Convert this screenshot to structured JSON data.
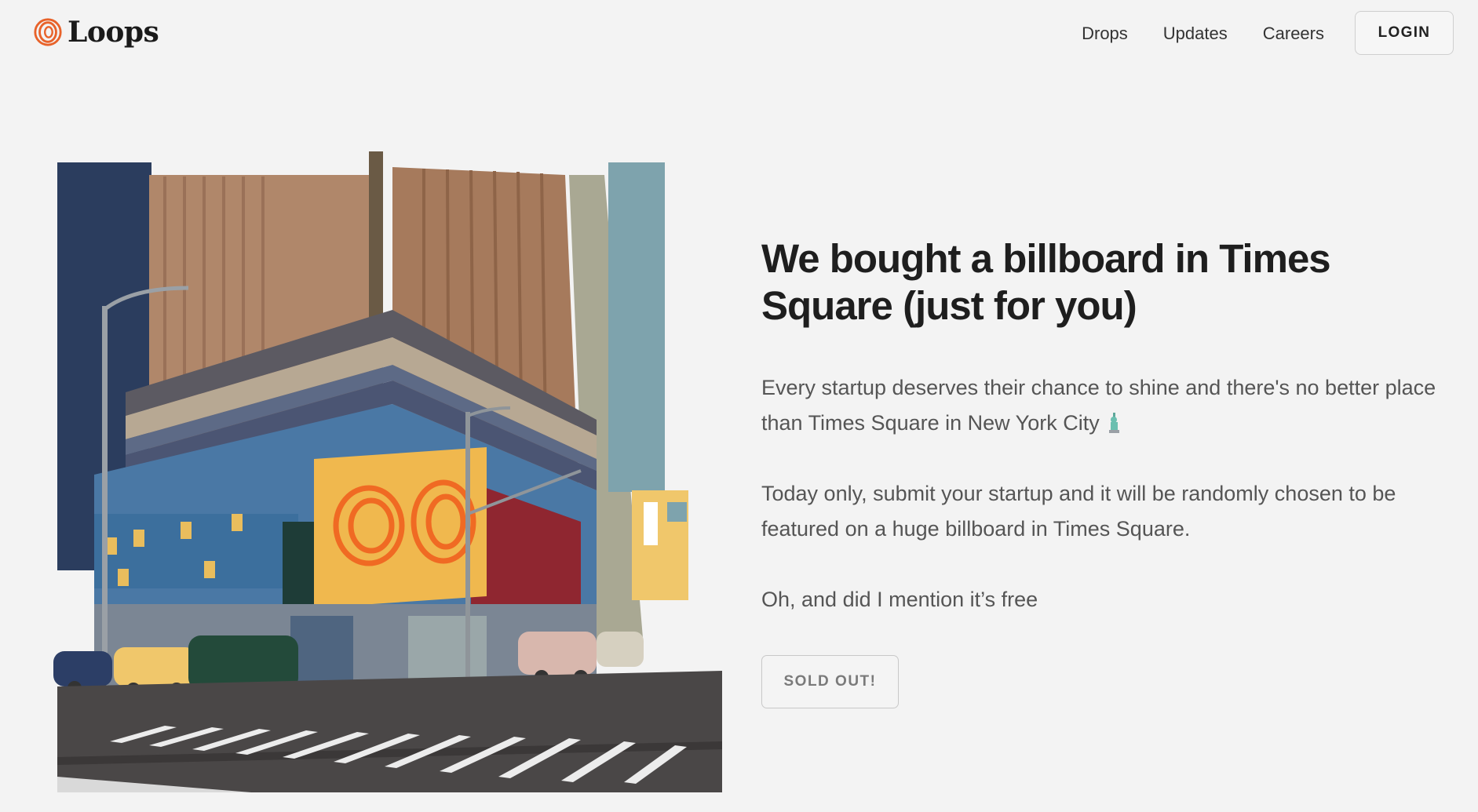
{
  "brand": {
    "name": "Loops",
    "accent": "#e8622a"
  },
  "nav": {
    "items": [
      {
        "label": "Drops"
      },
      {
        "label": "Updates"
      },
      {
        "label": "Careers"
      }
    ],
    "login_label": "LOGIN"
  },
  "hero": {
    "illustration_icon": "times-square-billboard-illustration",
    "headline": "We bought a billboard in Times Square (just for you)",
    "paragraph1": "Every startup deserves their chance to shine and there's no better place than Times Square in New York City",
    "paragraph1_emoji": "statue-of-liberty-icon",
    "paragraph2": "Today only, submit your startup and it will be randomly chosen to be featured on a huge billboard in Times Square.",
    "paragraph3": "Oh, and did I mention it’s free",
    "cta_label": "SOLD OUT!"
  }
}
